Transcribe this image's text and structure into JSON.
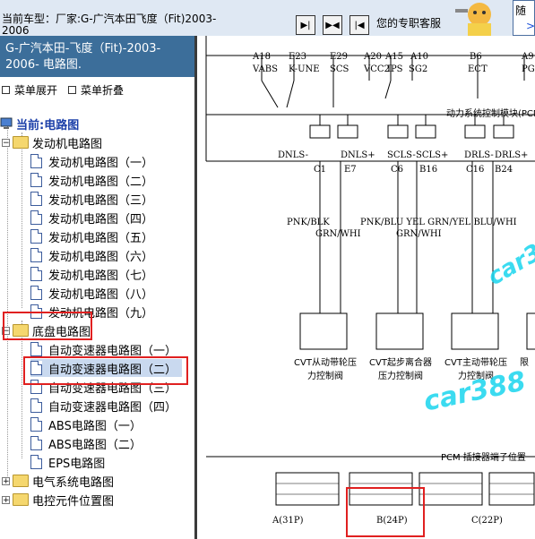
{
  "topbar": {
    "vehicle_label": "当前车型：厂家:G-广汽本田飞度（Fit)2003-2006",
    "service_label": "您的专职客服",
    "right_label": "随",
    "right_sub": ">"
  },
  "left": {
    "model_title": "G-广汽本田-飞度（Fit)-2003-2006- 电路图.",
    "expand_label": "菜单展开",
    "collapse_label": "菜单折叠",
    "root_label": "当前:电路图",
    "engine_folder": "发动机电路图",
    "engine_items": [
      "发动机电路图（一）",
      "发动机电路图（二）",
      "发动机电路图（三）",
      "发动机电路图（四）",
      "发动机电路图（五）",
      "发动机电路图（六）",
      "发动机电路图（七）",
      "发动机电路图（八）",
      "发动机电路图（九）"
    ],
    "chassis_folder": "底盘电路图",
    "chassis_items": [
      "自动变速器电路图（一）",
      "自动变速器电路图（二）",
      "自动变速器电路图（三）",
      "自动变速器电路图（四）",
      "ABS电路图（一）",
      "ABS电路图（二）",
      "EPS电路图"
    ],
    "electric_folder": "电气系统电路图",
    "parts_folder": "电控元件位置图"
  },
  "diagram": {
    "top_pins": [
      "A18",
      "E23",
      "E29",
      "A20",
      "A15",
      "A10",
      "B6",
      "A9"
    ],
    "top_signals": [
      "VABS",
      "K-UNE",
      "SCS",
      "VCC2",
      "IPS",
      "SG2",
      "ECT",
      "PG"
    ],
    "module_label": "动力系统控制模块(PCM)",
    "mid_signals": [
      "DNLS-",
      "DNLS+",
      "SCLS-",
      "SCLS+",
      "DRLS-",
      "DRLS+"
    ],
    "mid_pins": [
      "C1",
      "E7",
      "C6",
      "B16",
      "C16",
      "B24"
    ],
    "wire_row1": "PNK/BLK",
    "wire_row1b": "PNK/BLU YEL GRN/YEL BLU/WHI",
    "wire_row2a": "GRN/WHI",
    "wire_row2b": "GRN/WHI",
    "solenoids": [
      "CVT从动带轮压力控制阀",
      "CVT起步离合器压力控制阀",
      "CVT主动带轮压力控制阀",
      "限"
    ],
    "pcm_connector_label": "PCM 插接器端子位置",
    "connectors": [
      "A(31P)",
      "B(24P)",
      "C(22P)"
    ],
    "watermark": "car388"
  }
}
